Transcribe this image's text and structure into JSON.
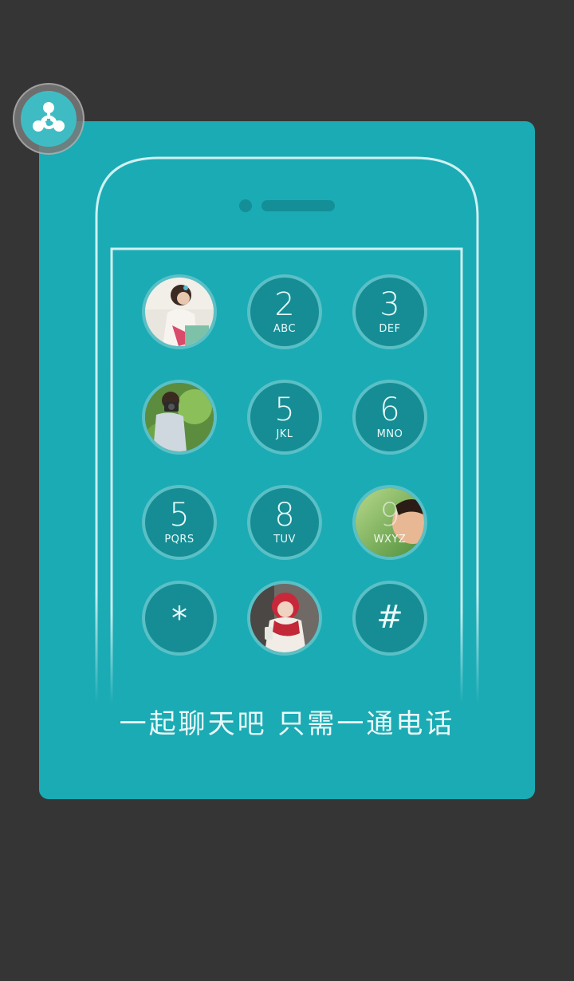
{
  "app": {
    "logo_icon": "app-logo-icon",
    "accent_color": "#1babb4"
  },
  "dialpad": {
    "keys": [
      {
        "digit": "",
        "letters": "",
        "photo": "girl-sitting-photo"
      },
      {
        "digit": "2",
        "letters": "ABC"
      },
      {
        "digit": "3",
        "letters": "DEF"
      },
      {
        "digit": "",
        "letters": "",
        "photo": "man-with-camera-photo"
      },
      {
        "digit": "5",
        "letters": "JKL"
      },
      {
        "digit": "6",
        "letters": "MNO"
      },
      {
        "digit": "5",
        "letters": "PQRS"
      },
      {
        "digit": "8",
        "letters": "TUV"
      },
      {
        "digit": "9",
        "letters": "WXYZ",
        "photo": "child-face-photo"
      },
      {
        "symbol": "*"
      },
      {
        "digit": "",
        "letters": "",
        "photo": "girl-red-scarf-photo"
      },
      {
        "symbol": "#"
      }
    ]
  },
  "tagline": "一起聊天吧 只需一通电话"
}
